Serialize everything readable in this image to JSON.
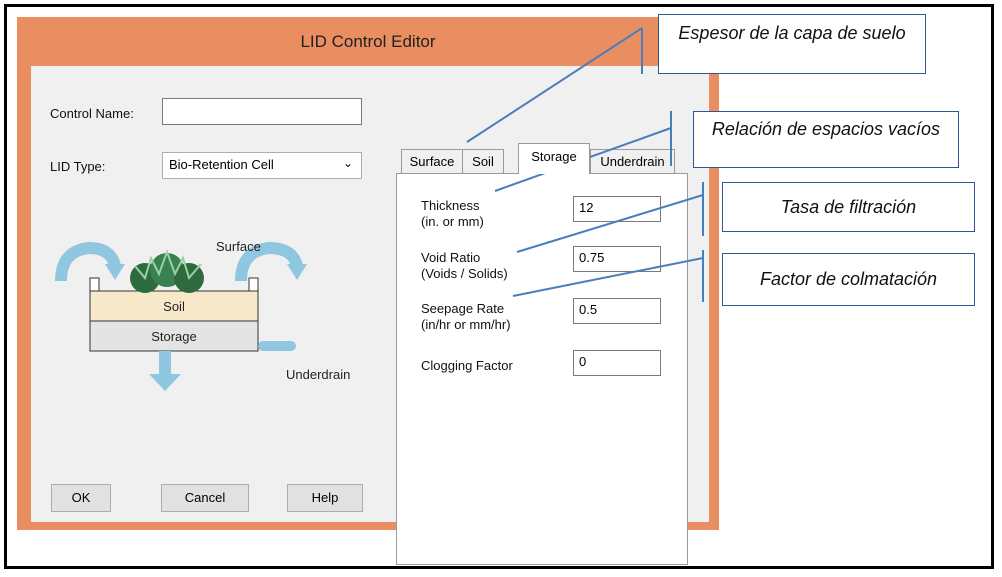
{
  "dialog": {
    "title": "LID Control Editor",
    "control_name_label": "Control Name:",
    "control_name_value": "",
    "lid_type_label": "LID Type:",
    "lid_type_value": "Bio-Retention Cell",
    "buttons": {
      "ok": "OK",
      "cancel": "Cancel",
      "help": "Help"
    }
  },
  "diagram": {
    "surface": "Surface",
    "soil": "Soil",
    "storage": "Storage",
    "underdrain": "Underdrain"
  },
  "tabs": [
    {
      "label": "Surface",
      "active": false
    },
    {
      "label": "Soil",
      "active": false
    },
    {
      "label": "Storage",
      "active": true
    },
    {
      "label": "Underdrain",
      "active": false
    }
  ],
  "storage": {
    "thickness": {
      "label1": "Thickness",
      "label2": "(in. or mm)",
      "value": "12"
    },
    "void_ratio": {
      "label1": "Void Ratio",
      "label2": "(Voids / Solids)",
      "value": "0.75"
    },
    "seepage_rate": {
      "label1": "Seepage Rate",
      "label2": "(in/hr or mm/hr)",
      "value": "0.5"
    },
    "clogging_factor": {
      "label1": "Clogging Factor",
      "value": "0"
    }
  },
  "callouts": {
    "espesor": "Espesor de la capa de suelo",
    "relacion": "Relación de espacios vacíos",
    "tasa": "Tasa de filtración",
    "factor": "Factor de colmatación"
  },
  "colors": {
    "window_frame": "#e98e61",
    "callout_line": "#4a7ebb",
    "arrow": "#8fc6e0"
  }
}
